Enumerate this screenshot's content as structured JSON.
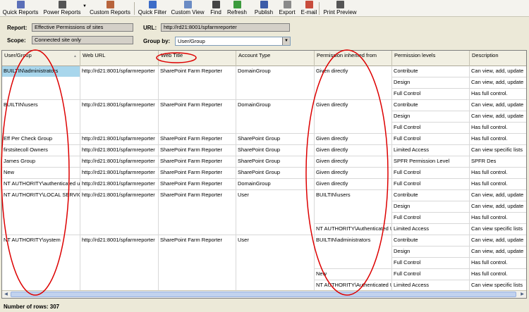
{
  "toolbar": {
    "buttons": [
      {
        "label": "Quick Reports",
        "icon": "report-icon",
        "color": "#5b6fb8"
      },
      {
        "label": "Power Reports",
        "icon": "tools-icon",
        "color": "#555555"
      },
      {
        "label": "Custom Reports",
        "icon": "custom-report-icon",
        "color": "#b8643c"
      },
      {
        "label": "Quick Filter",
        "icon": "filter-icon",
        "color": "#3c6cc8"
      },
      {
        "label": "Custom View",
        "icon": "view-icon",
        "color": "#6a8bc4"
      },
      {
        "label": "Find",
        "icon": "find-icon",
        "color": "#444444"
      },
      {
        "label": "Refresh",
        "icon": "refresh-icon",
        "color": "#3c9b3c"
      },
      {
        "label": "Publish",
        "icon": "publish-icon",
        "color": "#3c5ca8"
      },
      {
        "label": "Export",
        "icon": "export-icon",
        "color": "#8a8a8a"
      },
      {
        "label": "E-mail",
        "icon": "email-icon",
        "color": "#c84c3c"
      },
      {
        "label": "Print Preview",
        "icon": "print-preview-icon",
        "color": "#555555"
      }
    ]
  },
  "filters": {
    "report_label": "Report:",
    "report_value": "Effective Permissions of sites",
    "scope_label": "Scope:",
    "scope_value": "Connected site only",
    "url_label": "URL:",
    "url_value": "http://rd21:8001/spfarmreporter",
    "groupby_label": "Group by:",
    "groupby_value": "User/Group"
  },
  "grid": {
    "columns": [
      "User/Group",
      "Web URL",
      "Web Title",
      "Account Type",
      "Permission inherited from",
      "Permission levels",
      "Description"
    ],
    "rows": [
      [
        "BUILTIN\\administrators",
        "http://rd21:8001/spfarmreporter",
        "SharePoint Farm Reporter",
        "DomainGroup",
        "Given directly",
        "Contribute",
        "Can view, add, update"
      ],
      [
        "",
        "",
        "",
        "",
        "",
        "Design",
        "Can view, add, update"
      ],
      [
        "",
        "",
        "",
        "",
        "",
        "Full Control",
        "Has full control."
      ],
      [
        "BUILTIN\\users",
        "http://rd21:8001/spfarmreporter",
        "SharePoint Farm Reporter",
        "DomainGroup",
        "Given directly",
        "Contribute",
        "Can view, add, update"
      ],
      [
        "",
        "",
        "",
        "",
        "",
        "Design",
        "Can view, add, update"
      ],
      [
        "",
        "",
        "",
        "",
        "",
        "Full Control",
        "Has full control."
      ],
      [
        "Eff Per Check Group",
        "http://rd21:8001/spfarmreporter",
        "SharePoint Farm Reporter",
        "SharePoint Group",
        "Given directly",
        "Full Control",
        "Has full control."
      ],
      [
        "firstsitecoll Owners",
        "http://rd21:8001/spfarmreporter",
        "SharePoint Farm Reporter",
        "SharePoint Group",
        "Given directly",
        "Limited Access",
        "Can view specific lists"
      ],
      [
        "James Group",
        "http://rd21:8001/spfarmreporter",
        "SharePoint Farm Reporter",
        "SharePoint Group",
        "Given directly",
        "SPFR Permission Level",
        "SPFR Des"
      ],
      [
        "New",
        "http://rd21:8001/spfarmreporter",
        "SharePoint Farm Reporter",
        "SharePoint Group",
        "Given directly",
        "Full Control",
        "Has full control."
      ],
      [
        "NT AUTHORITY\\authenticated users",
        "http://rd21:8001/spfarmreporter",
        "SharePoint Farm Reporter",
        "DomainGroup",
        "Given directly",
        "Full Control",
        "Has full control."
      ],
      [
        "NT AUTHORITY\\LOCAL SERVICE",
        "http://rd21:8001/spfarmreporter",
        "SharePoint Farm Reporter",
        "User",
        "BUILTIN\\users",
        "Contribute",
        "Can view, add, update"
      ],
      [
        "",
        "",
        "",
        "",
        "",
        "Design",
        "Can view, add, update"
      ],
      [
        "",
        "",
        "",
        "",
        "",
        "Full Control",
        "Has full control."
      ],
      [
        "",
        "",
        "",
        "",
        "NT AUTHORITY\\Authenticated Users",
        "Limited Access",
        "Can view specific lists"
      ],
      [
        "NT AUTHORITY\\system",
        "http://rd21:8001/spfarmreporter",
        "SharePoint Farm Reporter",
        "User",
        "BUILTIN\\administrators",
        "Contribute",
        "Can view, add, update"
      ],
      [
        "",
        "",
        "",
        "",
        "",
        "Design",
        "Can view, add, update"
      ],
      [
        "",
        "",
        "",
        "",
        "",
        "Full Control",
        "Has full control."
      ],
      [
        "",
        "",
        "",
        "",
        "New",
        "Full Control",
        "Has full control."
      ],
      [
        "",
        "",
        "",
        "",
        "NT AUTHORITY\\Authenticated Users",
        "Limited Access",
        "Can view specific lists"
      ]
    ],
    "selected_row": 0
  },
  "status": {
    "rows_text": "Number of rows: 307"
  },
  "colors": {
    "selection": "#a8d6ec",
    "annotation": "#dd0000"
  }
}
